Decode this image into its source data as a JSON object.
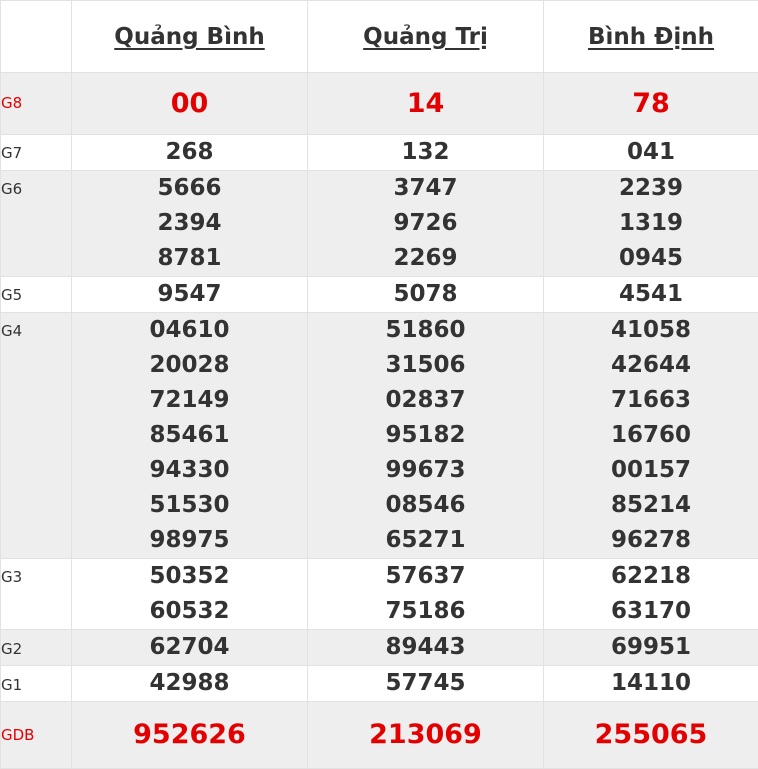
{
  "provinces": [
    "Quảng Bình",
    "Quảng Trị",
    "Bình Định"
  ],
  "rows": [
    {
      "label": "G8",
      "numbers": [
        [
          "00"
        ],
        [
          "14"
        ],
        [
          "78"
        ]
      ]
    },
    {
      "label": "G7",
      "numbers": [
        [
          "268"
        ],
        [
          "132"
        ],
        [
          "041"
        ]
      ]
    },
    {
      "label": "G6",
      "numbers": [
        [
          "5666",
          "2394",
          "8781"
        ],
        [
          "3747",
          "9726",
          "2269"
        ],
        [
          "2239",
          "1319",
          "0945"
        ]
      ]
    },
    {
      "label": "G5",
      "numbers": [
        [
          "9547"
        ],
        [
          "5078"
        ],
        [
          "4541"
        ]
      ]
    },
    {
      "label": "G4",
      "numbers": [
        [
          "04610",
          "20028",
          "72149",
          "85461",
          "94330",
          "51530",
          "98975"
        ],
        [
          "51860",
          "31506",
          "02837",
          "95182",
          "99673",
          "08546",
          "65271"
        ],
        [
          "41058",
          "42644",
          "71663",
          "16760",
          "00157",
          "85214",
          "96278"
        ]
      ]
    },
    {
      "label": "G3",
      "numbers": [
        [
          "50352",
          "60532"
        ],
        [
          "57637",
          "75186"
        ],
        [
          "62218",
          "63170"
        ]
      ]
    },
    {
      "label": "G2",
      "numbers": [
        [
          "62704"
        ],
        [
          "89443"
        ],
        [
          "69951"
        ]
      ]
    },
    {
      "label": "G1",
      "numbers": [
        [
          "42988"
        ],
        [
          "57745"
        ],
        [
          "14110"
        ]
      ]
    },
    {
      "label": "GDB",
      "numbers": [
        [
          "952626"
        ],
        [
          "213069"
        ],
        [
          "255065"
        ]
      ]
    }
  ],
  "colors": {
    "accent_red": "#e30000",
    "text": "#333333",
    "row_shade": "#eeeeee",
    "border": "#e2e2e2"
  }
}
